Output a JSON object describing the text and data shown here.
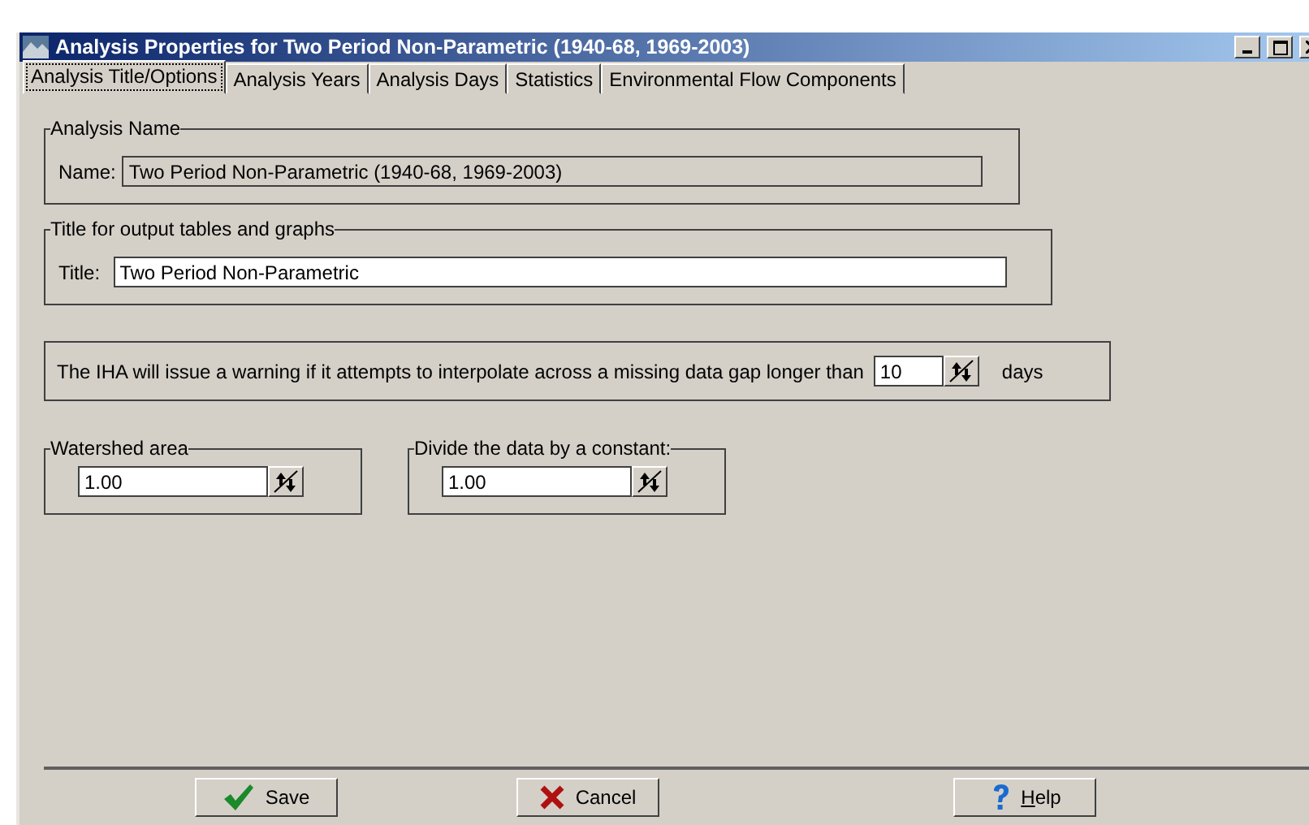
{
  "window": {
    "title": "Analysis Properties for Two Period Non-Parametric (1940-68, 1969-2003)"
  },
  "tabs": [
    {
      "label": "Analysis Title/Options",
      "selected": true
    },
    {
      "label": "Analysis Years",
      "selected": false
    },
    {
      "label": "Analysis Days",
      "selected": false
    },
    {
      "label": "Statistics",
      "selected": false
    },
    {
      "label": "Environmental Flow Components",
      "selected": false
    }
  ],
  "analysis_name": {
    "legend": "Analysis Name",
    "label": "Name:",
    "value": "Two Period Non-Parametric (1940-68, 1969-2003)",
    "disabled": true
  },
  "output_title": {
    "legend": "Title for output tables and graphs",
    "label": "Title:",
    "value": "Two Period Non-Parametric"
  },
  "gap_warning": {
    "text": "The IHA will issue a warning if it attempts to interpolate across a missing data gap  longer than",
    "value": "10",
    "unit": "days"
  },
  "watershed_area": {
    "legend": "Watershed area",
    "value": "1.00"
  },
  "divisor": {
    "legend": "Divide the data by a constant:",
    "value": "1.00"
  },
  "buttons": [
    {
      "kind": "save",
      "label": "Save"
    },
    {
      "kind": "cancel",
      "label": "Cancel"
    },
    {
      "kind": "help",
      "label": "Help"
    }
  ]
}
